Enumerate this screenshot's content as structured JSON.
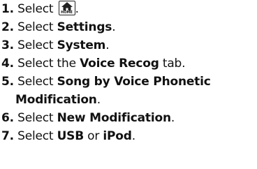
{
  "steps": [
    {
      "num": "1.",
      "text_before": "Select ",
      "bold": "",
      "text_after": ".",
      "icon": "home-icon",
      "icon_label": "HOME"
    },
    {
      "num": "2.",
      "text_before": "Select ",
      "bold": "Settings",
      "text_after": "."
    },
    {
      "num": "3.",
      "text_before": "Select ",
      "bold": "System",
      "text_after": "."
    },
    {
      "num": "4.",
      "text_before": "Select the ",
      "bold": "Voice Recog",
      "text_after": " tab."
    },
    {
      "num": "5.",
      "text_before": "Select ",
      "bold": "Song by Voice Phonetic",
      "bold_line2": "Modification",
      "text_after": "."
    },
    {
      "num": "6.",
      "text_before": "Select ",
      "bold": "New Modification",
      "text_after": "."
    },
    {
      "num": "7.",
      "text_before": "Select ",
      "bold": "USB",
      "text_mid": " or ",
      "bold2": "iPod",
      "text_after": "."
    }
  ]
}
